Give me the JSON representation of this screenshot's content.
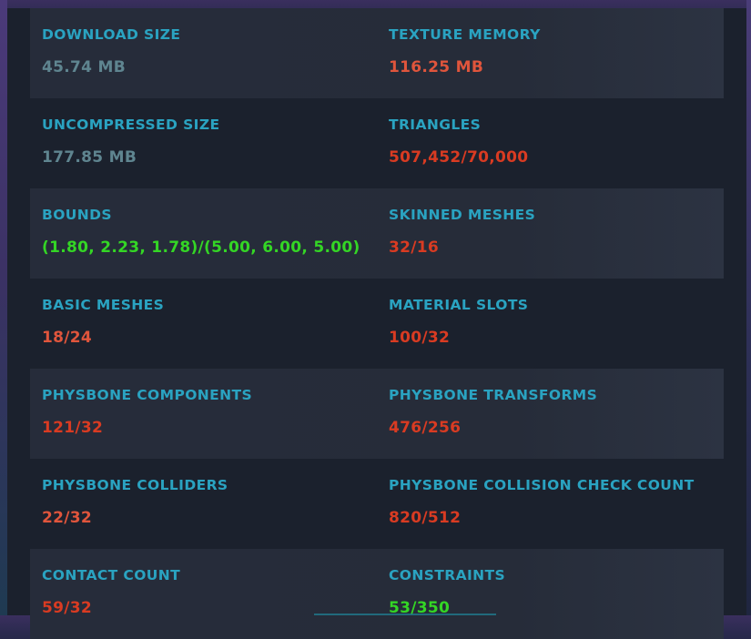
{
  "stats": [
    {
      "label": "DOWNLOAD SIZE",
      "value": "45.74 MB"
    },
    {
      "label": "TEXTURE MEMORY",
      "value": "116.25 MB"
    },
    {
      "label": "UNCOMPRESSED SIZE",
      "value": "177.85 MB"
    },
    {
      "label": "TRIANGLES",
      "value": "507,452/70,000"
    },
    {
      "label": "BOUNDS",
      "value": "(1.80, 2.23, 1.78)/(5.00, 6.00, 5.00)"
    },
    {
      "label": "SKINNED MESHES",
      "value": "32/16"
    },
    {
      "label": "BASIC MESHES",
      "value": "18/24"
    },
    {
      "label": "MATERIAL SLOTS",
      "value": "100/32"
    },
    {
      "label": "PHYSBONE COMPONENTS",
      "value": "121/32"
    },
    {
      "label": "PHYSBONE TRANSFORMS",
      "value": "476/256"
    },
    {
      "label": "PHYSBONE COLLIDERS",
      "value": "22/32"
    },
    {
      "label": "PHYSBONE COLLISION CHECK COUNT",
      "value": "820/512"
    },
    {
      "label": "CONTACT COUNT",
      "value": "59/32"
    },
    {
      "label": "CONSTRAINTS",
      "value": "53/350"
    }
  ],
  "colors": {
    "label": "#2aa3c1",
    "neutral": "#5f8590",
    "warning": "#e0553c",
    "error": "#d93b22",
    "ok": "#34d625"
  }
}
